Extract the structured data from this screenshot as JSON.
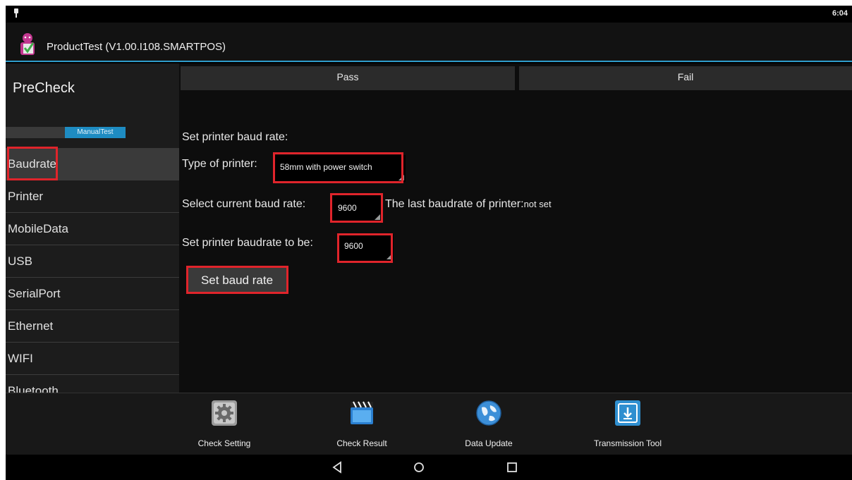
{
  "status_bar": {
    "time": "6:04"
  },
  "app": {
    "title": "ProductTest (V1.00.I108.SMARTPOS)"
  },
  "sidebar": {
    "heading": "PreCheck",
    "manual_test_label": "ManualTest",
    "items": [
      {
        "label": "Baudrate"
      },
      {
        "label": "Printer"
      },
      {
        "label": "MobileData"
      },
      {
        "label": "USB"
      },
      {
        "label": "SerialPort"
      },
      {
        "label": "Ethernet"
      },
      {
        "label": "WIFI"
      },
      {
        "label": "Bluetooth"
      }
    ]
  },
  "main": {
    "pass_label": "Pass",
    "fail_label": "Fail",
    "section_title": "Set printer baud rate:",
    "printer_type_label": "Type of printer:",
    "printer_type_value": "58mm with power switch",
    "current_baud_label": "Select current baud rate:",
    "current_baud_value": "9600",
    "last_baud_label": "The last baudrate of printer:",
    "last_baud_value": "not set",
    "target_baud_label": "Set printer baudrate to be:",
    "target_baud_value": "9600",
    "set_button_label": "Set baud rate"
  },
  "toolbar": {
    "items": [
      {
        "label": "Check Setting",
        "icon": "gear-icon"
      },
      {
        "label": "Check Result",
        "icon": "clapperboard-icon"
      },
      {
        "label": "Data Update",
        "icon": "globe-icon"
      },
      {
        "label": "Transmission Tool",
        "icon": "download-icon"
      }
    ]
  },
  "colors": {
    "accent": "#2f9dcc",
    "highlight": "#e0242b",
    "manual_test": "#1e8cc2"
  }
}
